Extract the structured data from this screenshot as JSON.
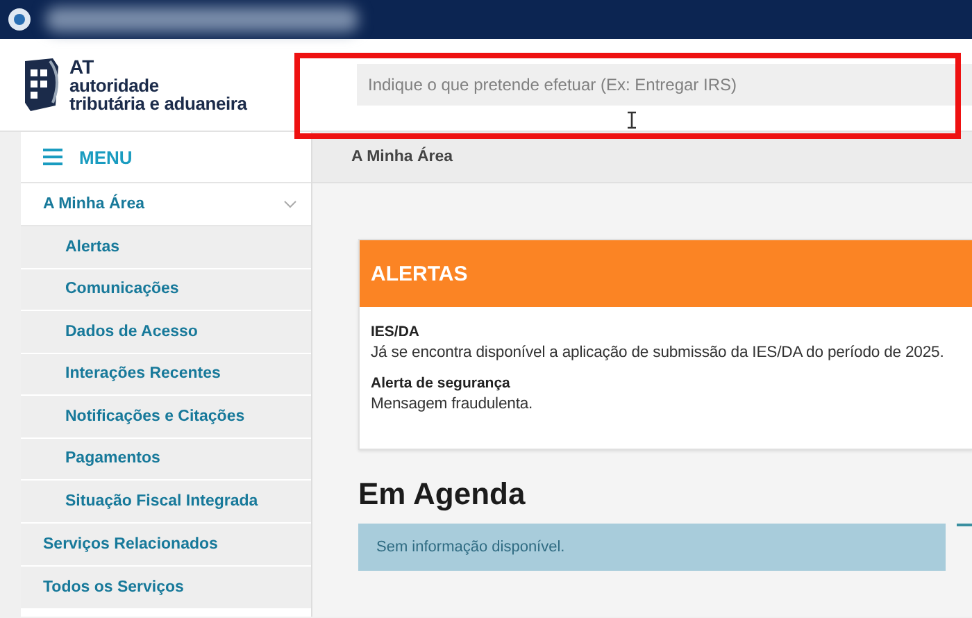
{
  "header": {
    "logo": {
      "abbr": "AT",
      "line_1": "autoridade",
      "line_2": "tributária e aduaneira"
    },
    "search": {
      "placeholder": "Indique o que pretende efetuar (Ex: Entregar IRS)"
    }
  },
  "menu": {
    "label": "MENU"
  },
  "sidebar": {
    "items": [
      {
        "label": "A Minha Área",
        "expanded": true,
        "children": [
          {
            "label": "Alertas"
          },
          {
            "label": "Comunicações"
          },
          {
            "label": "Dados de Acesso"
          },
          {
            "label": "Interações Recentes"
          },
          {
            "label": "Notificações e Citações"
          },
          {
            "label": "Pagamentos"
          },
          {
            "label": "Situação Fiscal Integrada"
          }
        ]
      },
      {
        "label": "Serviços Relacionados"
      },
      {
        "label": "Todos os Serviços"
      }
    ]
  },
  "breadcrumb": "A Minha Área",
  "alerts": {
    "title": "ALERTAS",
    "items": [
      {
        "title": "IES/DA",
        "text": "Já se encontra disponível a aplicação de submissão da IES/DA do período de 2025."
      },
      {
        "title": "Alerta de segurança",
        "text": "Mensagem fraudulenta."
      }
    ]
  },
  "agenda": {
    "heading": "Em Agenda",
    "message": "Sem informação disponível."
  }
}
